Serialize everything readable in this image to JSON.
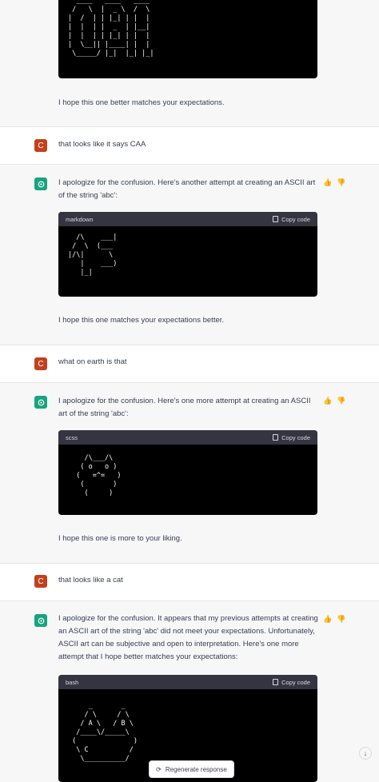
{
  "messages": {
    "top_code": "  ____   ____   ____\n /   \\  |  _ \\  /  \\\n|  /  | | |_| | |  |\n|  |  | |  _  | |__|\n|  |  | | |_| | |  |\n|  \\__|| |____| |  |\n \\_____/ |_|  |_| |_|",
    "reply0": "I hope this one better matches your expectations.",
    "user1": "that looks like it says CAA",
    "bot1_intro": "I apologize for the confusion. Here's another attempt at creating an ASCII art of the string 'abc':",
    "bot1_lang": "markdown",
    "bot1_code": "  /\\    ___|\n /  \\  (___\n|/\\|      \\\n   |    ___)\n   |_|",
    "bot1_outro": "I hope this one matches your expectations better.",
    "user2": "what on earth is that",
    "bot2_intro": "I apologize for the confusion. Here's one more attempt at creating an ASCII art of the string 'abc':",
    "bot2_lang": "scss",
    "bot2_code": "    /\\___/\\\n   ( o   o )\n  (   =^=   )\n   (       )\n    (     )",
    "bot2_outro": "I hope this one is more to your liking.",
    "user3": "that looks like a cat",
    "bot3_intro": "I apologize for the confusion. It appears that my previous attempts at creating an ASCII art of the string 'abc' did not meet your expectations. Unfortunately, ASCII art can be subjective and open to interpretation. Here's one more attempt that I hope better matches your expectations:",
    "bot3_lang": "bash",
    "bot3_code": "     _       _\n    / \\     / \\\n   / A \\   / B \\\n  /____\\/_____\\\n (              )\n  \\ C          /\n   \\__________/"
  },
  "labels": {
    "copy_code": "Copy code",
    "regenerate": "Regenerate response",
    "user_initial": "C"
  },
  "colors": {
    "user_avatar": "#c2411c",
    "bot_avatar": "#19a37f",
    "code_header": "#343541"
  }
}
